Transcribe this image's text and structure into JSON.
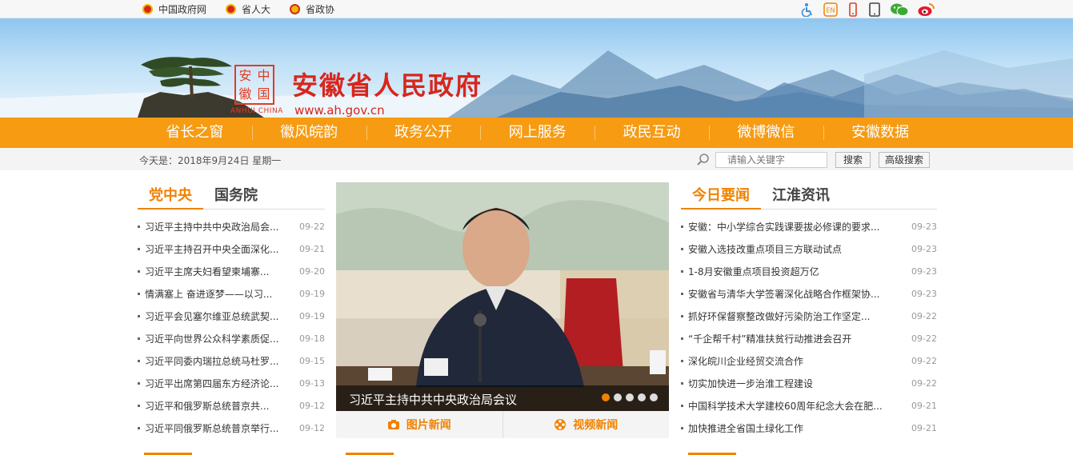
{
  "topbar": {
    "links": [
      {
        "label": "中国政府网"
      },
      {
        "label": "省人大"
      },
      {
        "label": "省政协"
      }
    ],
    "icons": [
      "accessibility-icon",
      "english-icon",
      "mobile-icon",
      "tablet-icon",
      "wechat-icon",
      "weibo-icon"
    ],
    "english_badge": "EN"
  },
  "header": {
    "logo_chars": [
      "安",
      "中",
      "徽",
      "国"
    ],
    "logo_en": "ANHUI CHINA",
    "title": "安徽省人民政府",
    "url": "www.ah.gov.cn"
  },
  "nav": {
    "items": [
      "省长之窗",
      "徽风皖韵",
      "政务公开",
      "网上服务",
      "政民互动",
      "微博微信",
      "安徽数据"
    ]
  },
  "subbar": {
    "date_text": "今天是：2018年9月24日 星期一",
    "search_placeholder": "请输入关键字",
    "search_button": "搜索",
    "advanced_button": "高级搜索"
  },
  "left": {
    "tabs": [
      "党中央",
      "国务院"
    ],
    "items": [
      {
        "title": "习近平主持中共中央政治局会...",
        "date": "09-22"
      },
      {
        "title": "习近平主持召开中央全面深化...",
        "date": "09-21"
      },
      {
        "title": "习近平主席夫妇看望柬埔寨...",
        "date": "09-20"
      },
      {
        "title": "情满塞上 奋进逐梦——以习...",
        "date": "09-19"
      },
      {
        "title": "习近平会见塞尔维亚总统武契...",
        "date": "09-19"
      },
      {
        "title": "习近平向世界公众科学素质促...",
        "date": "09-18"
      },
      {
        "title": "习近平同委内瑞拉总统马杜罗...",
        "date": "09-15"
      },
      {
        "title": "习近平出席第四届东方经济论...",
        "date": "09-13"
      },
      {
        "title": "习近平和俄罗斯总统普京共...",
        "date": "09-12"
      },
      {
        "title": "习近平同俄罗斯总统普京举行...",
        "date": "09-12"
      }
    ]
  },
  "center": {
    "caption": "习近平主持中共中央政治局会议",
    "slide_count": 5,
    "active_slide": 1,
    "photo_news": "图片新闻",
    "video_news": "视频新闻"
  },
  "right": {
    "tabs": [
      "今日要闻",
      "江淮资讯"
    ],
    "items": [
      {
        "title": "安徽：中小学综合实践课要拔必修课的要求...",
        "date": "09-23"
      },
      {
        "title": "安徽入选技改重点项目三方联动试点",
        "date": "09-23"
      },
      {
        "title": "1-8月安徽重点项目投资超万亿",
        "date": "09-23"
      },
      {
        "title": "安徽省与清华大学签署深化战略合作框架协...",
        "date": "09-23"
      },
      {
        "title": "抓好环保督察整改做好污染防治工作坚定...",
        "date": "09-22"
      },
      {
        "title": "“千企帮千村”精准扶贫行动推进会召开",
        "date": "09-22"
      },
      {
        "title": "深化皖川企业经贸交流合作",
        "date": "09-22"
      },
      {
        "title": "切实加快进一步治淮工程建设",
        "date": "09-22"
      },
      {
        "title": "中国科学技术大学建校60周年纪念大会在肥...",
        "date": "09-21"
      },
      {
        "title": "加快推进全省国土绿化工作",
        "date": "09-21"
      }
    ]
  },
  "colors": {
    "nav_bg": "#f69b12",
    "accent": "#f08200",
    "title_red": "#d8261c"
  }
}
